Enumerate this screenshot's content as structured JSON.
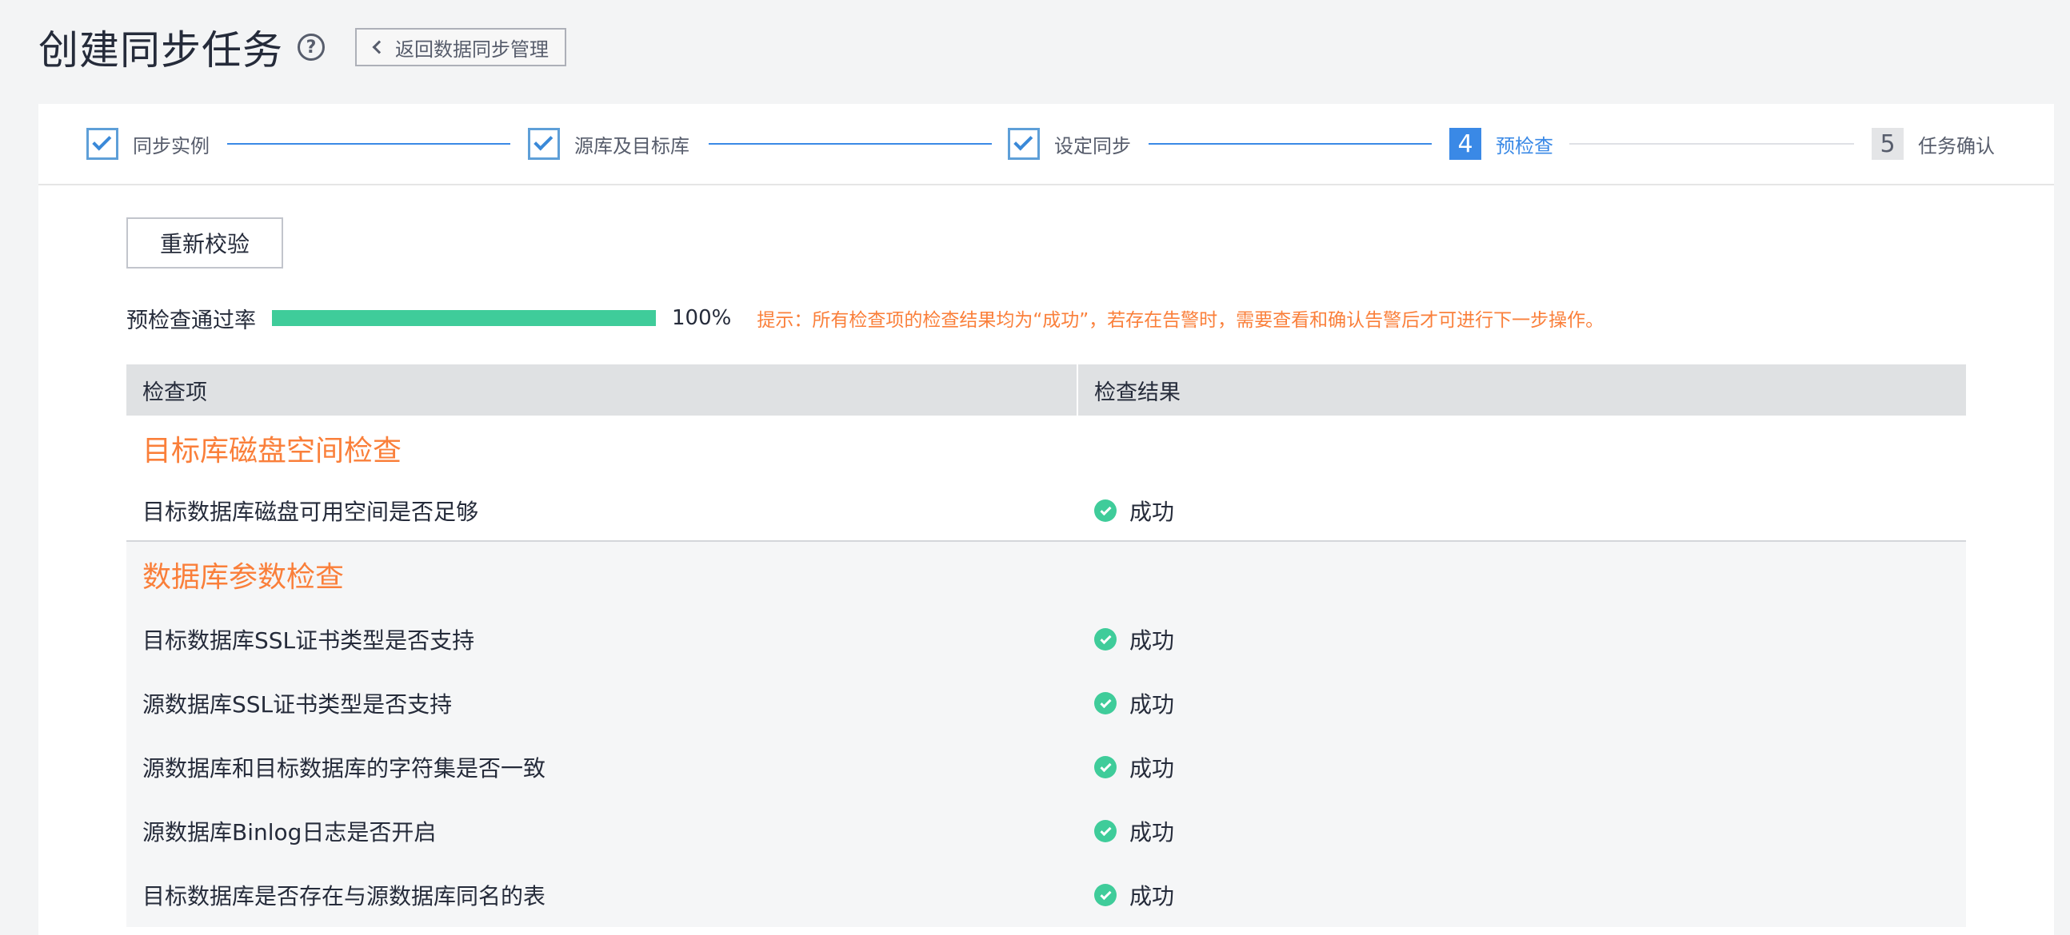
{
  "header": {
    "title": "创建同步任务",
    "help_icon": "question-circle-icon",
    "back_label": "返回数据同步管理"
  },
  "steps": [
    {
      "label": "同步实例",
      "state": "done"
    },
    {
      "label": "源库及目标库",
      "state": "done"
    },
    {
      "label": "设定同步",
      "state": "done"
    },
    {
      "number": "4",
      "label": "预检查",
      "state": "active"
    },
    {
      "number": "5",
      "label": "任务确认",
      "state": "pending"
    }
  ],
  "actions": {
    "recheck_label": "重新校验"
  },
  "pass_rate": {
    "label": "预检查通过率",
    "value_text": "100%",
    "fraction": 1.0,
    "tip": "提示：所有检查项的检查结果均为“成功”，若存在告警时，需要查看和确认告警后才可进行下一步操作。"
  },
  "table": {
    "headers": [
      "检查项",
      "检查结果"
    ],
    "groups": [
      {
        "title": "目标库磁盘空间检查",
        "rows": [
          {
            "item": "目标数据库磁盘可用空间是否足够",
            "result": "成功"
          }
        ]
      },
      {
        "title": "数据库参数检查",
        "rows": [
          {
            "item": "目标数据库SSL证书类型是否支持",
            "result": "成功"
          },
          {
            "item": "源数据库SSL证书类型是否支持",
            "result": "成功"
          },
          {
            "item": "源数据库和目标数据库的字符集是否一致",
            "result": "成功"
          },
          {
            "item": "源数据库Binlog日志是否开启",
            "result": "成功"
          },
          {
            "item": "目标数据库是否存在与源数据库同名的表",
            "result": "成功"
          }
        ]
      }
    ]
  },
  "colors": {
    "accent": "#3a89e6",
    "success": "#3fcc9a",
    "warning": "#fa7f3a"
  }
}
